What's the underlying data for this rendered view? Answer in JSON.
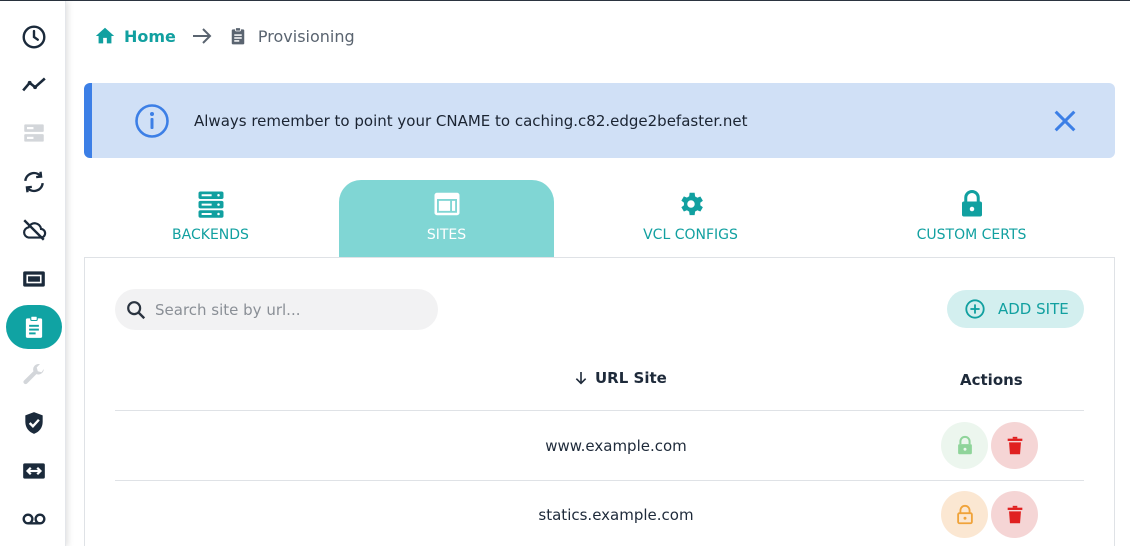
{
  "sidebar": {
    "items": [
      {
        "icon": "clock-icon",
        "active": false
      },
      {
        "icon": "trend-icon",
        "active": false
      },
      {
        "icon": "server-icon",
        "active": false
      },
      {
        "icon": "sync-icon",
        "active": false
      },
      {
        "icon": "cloud-off-icon",
        "active": false
      },
      {
        "icon": "ticket-icon",
        "active": false
      },
      {
        "icon": "clipboard-icon",
        "active": true
      },
      {
        "icon": "wrench-icon",
        "active": false
      },
      {
        "icon": "shield-check-icon",
        "active": false
      },
      {
        "icon": "swap-icon",
        "active": false
      },
      {
        "icon": "voicemail-icon",
        "active": false
      }
    ]
  },
  "breadcrumb": {
    "home": "Home",
    "current": "Provisioning"
  },
  "alert": {
    "message": "Always remember to point your CNAME to caching.c82.edge2befaster.net"
  },
  "tabs": [
    {
      "label": "BACKENDS",
      "icon": "server-stack-icon",
      "active": false
    },
    {
      "label": "SITES",
      "icon": "web-icon",
      "active": true
    },
    {
      "label": "VCL CONFIGS",
      "icon": "gear-icon",
      "active": false
    },
    {
      "label": "CUSTOM CERTS",
      "icon": "lock-icon",
      "active": false
    }
  ],
  "search": {
    "placeholder": "Search site by url..."
  },
  "add_button": {
    "label": "ADD SITE"
  },
  "table": {
    "columns": [
      "URL Site",
      "Actions"
    ],
    "rows": [
      {
        "url": "www.example.com",
        "lock_state": "locked"
      },
      {
        "url": "statics.example.com",
        "lock_state": "unlocked"
      }
    ]
  },
  "colors": {
    "accent": "#11a0a0",
    "active_tab": "#80d6d4",
    "alert_bg": "#d0e0f6",
    "alert_border": "#3c7fe6",
    "lock_green": "#6cc57a",
    "lock_orange": "#f0a33a",
    "delete_red": "#e02020"
  }
}
